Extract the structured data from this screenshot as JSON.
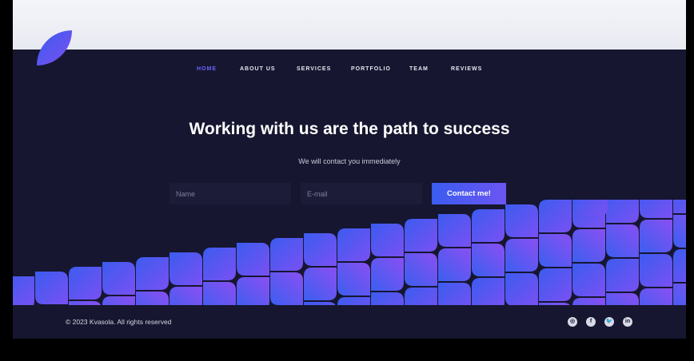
{
  "nav": {
    "items": [
      {
        "label": "HOME",
        "active": true
      },
      {
        "label": "ABOUT US",
        "active": false
      },
      {
        "label": "SERVICES",
        "active": false
      },
      {
        "label": "PORTFOLIO",
        "active": false
      },
      {
        "label": "TEAM",
        "active": false
      },
      {
        "label": "REVIEWS",
        "active": false
      }
    ]
  },
  "hero": {
    "title": "Working with us are the path to success",
    "subtitle": "We will contact you immediately"
  },
  "form": {
    "name_placeholder": "Name",
    "email_placeholder": "E-mail",
    "submit_label": "Contact me!"
  },
  "footer": {
    "copyright": "© 2023   Kvasola. All rights reserved",
    "social": [
      {
        "icon": "instagram-icon",
        "glyph": "◎"
      },
      {
        "icon": "facebook-icon",
        "glyph": "f"
      },
      {
        "icon": "twitter-icon",
        "glyph": "🐦"
      },
      {
        "icon": "linkedin-icon",
        "glyph": "in"
      }
    ]
  },
  "colors": {
    "background": "#161630",
    "accent_blue": "#3b5cf0",
    "accent_purple": "#7b4ff0",
    "nav_active": "#6c63ff"
  }
}
